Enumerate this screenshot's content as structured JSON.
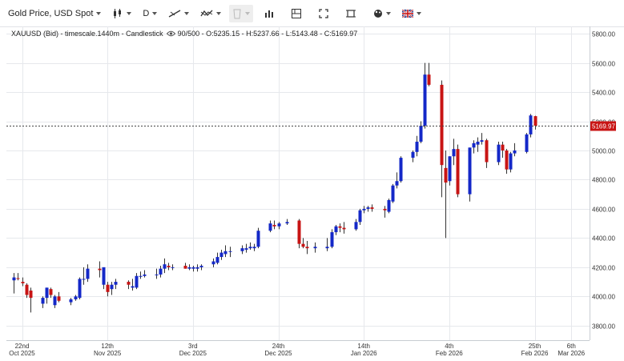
{
  "toolbar": {
    "symbol": "Gold Price, USD Spot",
    "timeframe": "D",
    "icons": [
      "candlestick-type-icon",
      "drawing-line-icon",
      "indicator-icon",
      "template-icon",
      "bar-chart-icon",
      "layout-icon",
      "fullscreen-icon",
      "screenshot-icon",
      "palette-icon",
      "flag-icon"
    ]
  },
  "header": {
    "symbol": "XAUUSD (Bid)",
    "timescale": "timescale.1440m",
    "chart_type": "Candlestick",
    "bar_count": "90/500",
    "ohlc_text": "O:5235.15 - H:5237.66 - L:5143.48 - C:5169.97"
  },
  "last_price": {
    "label": "5169.97",
    "value": 5169.97
  },
  "colors": {
    "up": "#1428c8",
    "down": "#c81414",
    "grid": "#e6e8ec",
    "text": "#333333"
  },
  "chart_data": {
    "type": "candlestick",
    "ylim": [
      3700,
      5850
    ],
    "y_ticks": [
      "3800.00",
      "4000.00",
      "4200.00",
      "4400.00",
      "4600.00",
      "4800.00",
      "5000.00",
      "5200.00",
      "5400.00",
      "5600.00",
      "5800.00"
    ],
    "x_ticks": [
      {
        "label1": "22nd",
        "label2": "Oct 2025",
        "date": "2025-10-22"
      },
      {
        "label1": "12th",
        "label2": "Nov 2025",
        "date": "2025-11-12"
      },
      {
        "label1": "3rd",
        "label2": "Dec 2025",
        "date": "2025-12-03"
      },
      {
        "label1": "24th",
        "label2": "Dec 2025",
        "date": "2025-12-24"
      },
      {
        "label1": "14th",
        "label2": "Jan 2026",
        "date": "2026-01-14"
      },
      {
        "label1": "4th",
        "label2": "Feb 2026",
        "date": "2026-02-04"
      },
      {
        "label1": "25th",
        "label2": "Feb 2026",
        "date": "2026-02-25"
      },
      {
        "label1": "6th",
        "label2": "Mar 2026",
        "date": "2026-03-06"
      }
    ],
    "candles": [
      {
        "date": "2025-10-20",
        "o": 4110,
        "h": 4160,
        "l": 4020,
        "c": 4130
      },
      {
        "date": "2025-10-21",
        "o": 4125,
        "h": 4160,
        "l": 4110,
        "c": 4120
      },
      {
        "date": "2025-10-22",
        "o": 4100,
        "h": 4130,
        "l": 4070,
        "c": 4090
      },
      {
        "date": "2025-10-23",
        "o": 4080,
        "h": 4090,
        "l": 3990,
        "c": 4010
      },
      {
        "date": "2025-10-24",
        "o": 4040,
        "h": 4060,
        "l": 3890,
        "c": 3990
      },
      {
        "date": "2025-10-27",
        "o": 3950,
        "h": 4000,
        "l": 3920,
        "c": 3990
      },
      {
        "date": "2025-10-28",
        "o": 3990,
        "h": 4060,
        "l": 3950,
        "c": 4060
      },
      {
        "date": "2025-10-29",
        "o": 4050,
        "h": 4060,
        "l": 3990,
        "c": 4010
      },
      {
        "date": "2025-10-30",
        "o": 3940,
        "h": 4010,
        "l": 3920,
        "c": 4000
      },
      {
        "date": "2025-10-31",
        "o": 4000,
        "h": 4030,
        "l": 3960,
        "c": 3970
      },
      {
        "date": "2025-11-03",
        "o": 3960,
        "h": 3990,
        "l": 3940,
        "c": 3980
      },
      {
        "date": "2025-11-04",
        "o": 3980,
        "h": 4010,
        "l": 3970,
        "c": 4000
      },
      {
        "date": "2025-11-05",
        "o": 3990,
        "h": 4130,
        "l": 3980,
        "c": 4120
      },
      {
        "date": "2025-11-06",
        "o": 4120,
        "h": 4200,
        "l": 4080,
        "c": 4120
      },
      {
        "date": "2025-11-07",
        "o": 4120,
        "h": 4220,
        "l": 4100,
        "c": 4190
      },
      {
        "date": "2025-11-10",
        "o": 4190,
        "h": 4240,
        "l": 4130,
        "c": 4180
      },
      {
        "date": "2025-11-11",
        "o": 4080,
        "h": 4190,
        "l": 4050,
        "c": 4200
      },
      {
        "date": "2025-11-12",
        "o": 4080,
        "h": 4100,
        "l": 4000,
        "c": 4030
      },
      {
        "date": "2025-11-13",
        "o": 4050,
        "h": 4100,
        "l": 4010,
        "c": 4080
      },
      {
        "date": "2025-11-14",
        "o": 4080,
        "h": 4120,
        "l": 4050,
        "c": 4100
      },
      {
        "date": "2025-11-17",
        "o": 4100,
        "h": 4110,
        "l": 4050,
        "c": 4080
      },
      {
        "date": "2025-11-18",
        "o": 4060,
        "h": 4120,
        "l": 4040,
        "c": 4070
      },
      {
        "date": "2025-11-19",
        "o": 4060,
        "h": 4160,
        "l": 4050,
        "c": 4140
      },
      {
        "date": "2025-11-20",
        "o": 4140,
        "h": 4170,
        "l": 4120,
        "c": 4140
      },
      {
        "date": "2025-11-21",
        "o": 4140,
        "h": 4180,
        "l": 4130,
        "c": 4150
      },
      {
        "date": "2025-11-24",
        "o": 4150,
        "h": 4190,
        "l": 4120,
        "c": 4150
      },
      {
        "date": "2025-11-25",
        "o": 4150,
        "h": 4210,
        "l": 4130,
        "c": 4190
      },
      {
        "date": "2025-11-26",
        "o": 4190,
        "h": 4260,
        "l": 4160,
        "c": 4220
      },
      {
        "date": "2025-11-27",
        "o": 4210,
        "h": 4230,
        "l": 4180,
        "c": 4200
      },
      {
        "date": "2025-11-28",
        "o": 4200,
        "h": 4220,
        "l": 4180,
        "c": 4200
      },
      {
        "date": "2025-12-01",
        "o": 4210,
        "h": 4230,
        "l": 4190,
        "c": 4190
      },
      {
        "date": "2025-12-02",
        "o": 4190,
        "h": 4220,
        "l": 4180,
        "c": 4200
      },
      {
        "date": "2025-12-03",
        "o": 4190,
        "h": 4210,
        "l": 4170,
        "c": 4200
      },
      {
        "date": "2025-12-04",
        "o": 4190,
        "h": 4220,
        "l": 4170,
        "c": 4200
      },
      {
        "date": "2025-12-05",
        "o": 4200,
        "h": 4220,
        "l": 4180,
        "c": 4210
      },
      {
        "date": "2025-12-08",
        "o": 4220,
        "h": 4260,
        "l": 4200,
        "c": 4240
      },
      {
        "date": "2025-12-09",
        "o": 4230,
        "h": 4300,
        "l": 4220,
        "c": 4270
      },
      {
        "date": "2025-12-10",
        "o": 4270,
        "h": 4320,
        "l": 4250,
        "c": 4300
      },
      {
        "date": "2025-12-11",
        "o": 4290,
        "h": 4350,
        "l": 4270,
        "c": 4310
      },
      {
        "date": "2025-12-12",
        "o": 4310,
        "h": 4340,
        "l": 4270,
        "c": 4310
      },
      {
        "date": "2025-12-15",
        "o": 4310,
        "h": 4350,
        "l": 4290,
        "c": 4330
      },
      {
        "date": "2025-12-16",
        "o": 4320,
        "h": 4360,
        "l": 4300,
        "c": 4330
      },
      {
        "date": "2025-12-17",
        "o": 4330,
        "h": 4370,
        "l": 4320,
        "c": 4340
      },
      {
        "date": "2025-12-18",
        "o": 4330,
        "h": 4360,
        "l": 4310,
        "c": 4340
      },
      {
        "date": "2025-12-19",
        "o": 4340,
        "h": 4470,
        "l": 4330,
        "c": 4450
      },
      {
        "date": "2025-12-22",
        "o": 4450,
        "h": 4520,
        "l": 4440,
        "c": 4500
      },
      {
        "date": "2025-12-23",
        "o": 4490,
        "h": 4520,
        "l": 4460,
        "c": 4480
      },
      {
        "date": "2025-12-24",
        "o": 4480,
        "h": 4510,
        "l": 4460,
        "c": 4500
      },
      {
        "date": "2025-12-26",
        "o": 4500,
        "h": 4530,
        "l": 4490,
        "c": 4510
      },
      {
        "date": "2025-12-29",
        "o": 4520,
        "h": 4530,
        "l": 4330,
        "c": 4360
      },
      {
        "date": "2025-12-30",
        "o": 4360,
        "h": 4400,
        "l": 4330,
        "c": 4340
      },
      {
        "date": "2025-12-31",
        "o": 4340,
        "h": 4380,
        "l": 4290,
        "c": 4330
      },
      {
        "date": "2026-01-02",
        "o": 4330,
        "h": 4370,
        "l": 4300,
        "c": 4340
      },
      {
        "date": "2026-01-05",
        "o": 4330,
        "h": 4400,
        "l": 4310,
        "c": 4340
      },
      {
        "date": "2026-01-06",
        "o": 4340,
        "h": 4460,
        "l": 4330,
        "c": 4440
      },
      {
        "date": "2026-01-07",
        "o": 4440,
        "h": 4490,
        "l": 4420,
        "c": 4480
      },
      {
        "date": "2026-01-08",
        "o": 4480,
        "h": 4500,
        "l": 4440,
        "c": 4470
      },
      {
        "date": "2026-01-09",
        "o": 4470,
        "h": 4510,
        "l": 4430,
        "c": 4460
      },
      {
        "date": "2026-01-12",
        "o": 4460,
        "h": 4530,
        "l": 4450,
        "c": 4510
      },
      {
        "date": "2026-01-13",
        "o": 4510,
        "h": 4600,
        "l": 4490,
        "c": 4590
      },
      {
        "date": "2026-01-14",
        "o": 4590,
        "h": 4620,
        "l": 4570,
        "c": 4600
      },
      {
        "date": "2026-01-15",
        "o": 4600,
        "h": 4620,
        "l": 4580,
        "c": 4610
      },
      {
        "date": "2026-01-16",
        "o": 4610,
        "h": 4630,
        "l": 4580,
        "c": 4600
      },
      {
        "date": "2026-01-19",
        "o": 4600,
        "h": 4620,
        "l": 4540,
        "c": 4590
      },
      {
        "date": "2026-01-20",
        "o": 4580,
        "h": 4670,
        "l": 4570,
        "c": 4660
      },
      {
        "date": "2026-01-21",
        "o": 4650,
        "h": 4770,
        "l": 4640,
        "c": 4760
      },
      {
        "date": "2026-01-22",
        "o": 4760,
        "h": 4850,
        "l": 4740,
        "c": 4790
      },
      {
        "date": "2026-01-23",
        "o": 4790,
        "h": 4960,
        "l": 4780,
        "c": 4950
      },
      {
        "date": "2026-01-26",
        "o": 4950,
        "h": 5000,
        "l": 4920,
        "c": 4990
      },
      {
        "date": "2026-01-27",
        "o": 4990,
        "h": 5100,
        "l": 4960,
        "c": 5060
      },
      {
        "date": "2026-01-28",
        "o": 5060,
        "h": 5200,
        "l": 5050,
        "c": 5170
      },
      {
        "date": "2026-01-29",
        "o": 5170,
        "h": 5600,
        "l": 5150,
        "c": 5520
      },
      {
        "date": "2026-01-30",
        "o": 5520,
        "h": 5600,
        "l": 5440,
        "c": 5450
      },
      {
        "date": "2026-02-02",
        "o": 5450,
        "h": 5480,
        "l": 4680,
        "c": 4900
      },
      {
        "date": "2026-02-03",
        "o": 4880,
        "h": 5000,
        "l": 4400,
        "c": 4780
      },
      {
        "date": "2026-02-04",
        "o": 4790,
        "h": 4960,
        "l": 4760,
        "c": 4960
      },
      {
        "date": "2026-02-05",
        "o": 4960,
        "h": 5080,
        "l": 4900,
        "c": 5010
      },
      {
        "date": "2026-02-06",
        "o": 5010,
        "h": 5040,
        "l": 4680,
        "c": 4700
      },
      {
        "date": "2026-02-09",
        "o": 4700,
        "h": 5020,
        "l": 4650,
        "c": 5020
      },
      {
        "date": "2026-02-10",
        "o": 5020,
        "h": 5070,
        "l": 4980,
        "c": 5050
      },
      {
        "date": "2026-02-11",
        "o": 5040,
        "h": 5090,
        "l": 4990,
        "c": 5060
      },
      {
        "date": "2026-02-12",
        "o": 5060,
        "h": 5120,
        "l": 5040,
        "c": 5070
      },
      {
        "date": "2026-02-13",
        "o": 5070,
        "h": 5080,
        "l": 4880,
        "c": 4920
      },
      {
        "date": "2026-02-16",
        "o": 4920,
        "h": 5060,
        "l": 4900,
        "c": 5040
      },
      {
        "date": "2026-02-17",
        "o": 5040,
        "h": 5060,
        "l": 4950,
        "c": 5000
      },
      {
        "date": "2026-02-18",
        "o": 5000,
        "h": 5010,
        "l": 4840,
        "c": 4870
      },
      {
        "date": "2026-02-19",
        "o": 4870,
        "h": 4990,
        "l": 4850,
        "c": 4980
      },
      {
        "date": "2026-02-20",
        "o": 4980,
        "h": 5050,
        "l": 4960,
        "c": 5000
      },
      {
        "date": "2026-02-23",
        "o": 4990,
        "h": 5120,
        "l": 4980,
        "c": 5110
      },
      {
        "date": "2026-02-24",
        "o": 5110,
        "h": 5250,
        "l": 5090,
        "c": 5240
      },
      {
        "date": "2026-02-25",
        "o": 5235.15,
        "h": 5237.66,
        "l": 5143.48,
        "c": 5169.97
      }
    ]
  }
}
